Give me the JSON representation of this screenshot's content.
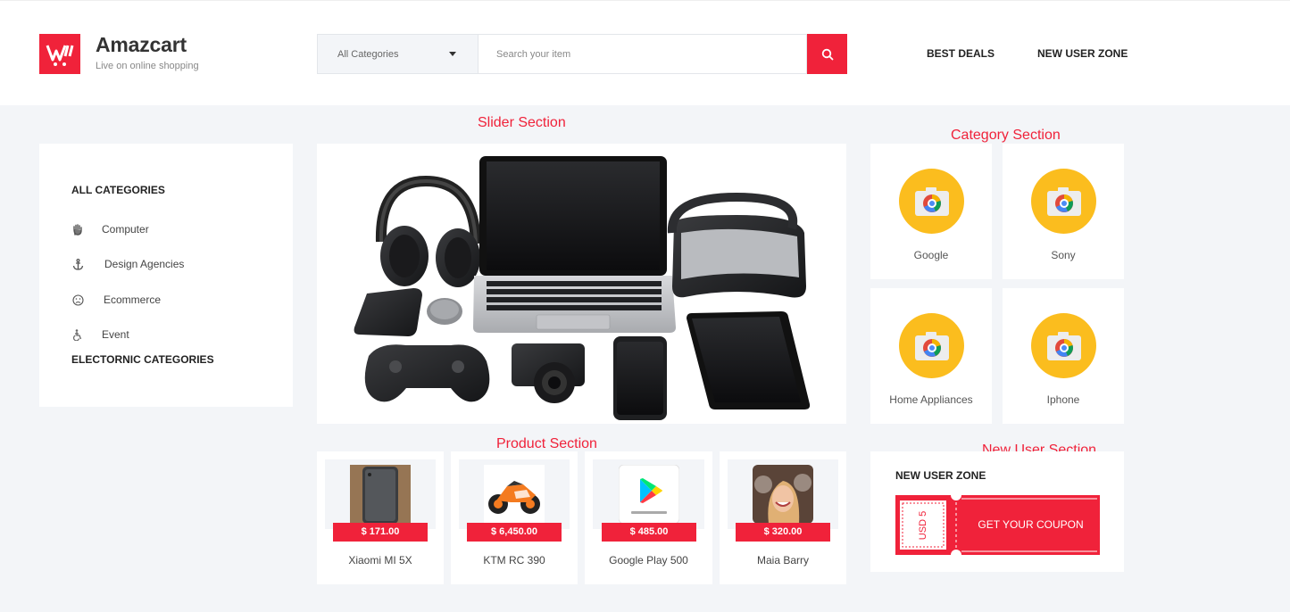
{
  "brand": {
    "name": "Amazcart",
    "tagline": "Live on online shopping",
    "accent": "#f0223a"
  },
  "search": {
    "category_selected": "All Categories",
    "placeholder": "Search your item",
    "value": ""
  },
  "nav": {
    "best_deals": "BEST DEALS",
    "new_user_zone": "NEW USER ZONE"
  },
  "annotations": {
    "slider": "Slider Section",
    "category": "Category Section",
    "product": "Product Section",
    "new_user": "New User Section"
  },
  "sidebar": {
    "title": "ALL CATEGORIES",
    "items": [
      {
        "label": "Computer",
        "icon": "hand-icon"
      },
      {
        "label": "Design Agencies",
        "icon": "anchor-icon"
      },
      {
        "label": "Ecommerce",
        "icon": "smiley-icon"
      },
      {
        "label": "Event",
        "icon": "accessibility-icon"
      }
    ],
    "subtitle": "ELECTORNIC CATEGORIES"
  },
  "categories": [
    {
      "label": "Google",
      "icon": "camera-icon"
    },
    {
      "label": "Sony",
      "icon": "camera-icon"
    },
    {
      "label": "Home Appliances",
      "icon": "camera-icon"
    },
    {
      "label": "Iphone",
      "icon": "camera-icon"
    }
  ],
  "products": [
    {
      "name": "Xiaomi MI 5X",
      "price": "$ 171.00"
    },
    {
      "name": "KTM RC 390",
      "price": "$ 6,450.00"
    },
    {
      "name": "Google Play 500",
      "price": "$ 485.00"
    },
    {
      "name": "Maia Barry",
      "price": "$ 320.00"
    }
  ],
  "new_user": {
    "title": "NEW USER ZONE",
    "coupon_value": "USD 5",
    "coupon_cta": "GET YOUR COUPON"
  }
}
